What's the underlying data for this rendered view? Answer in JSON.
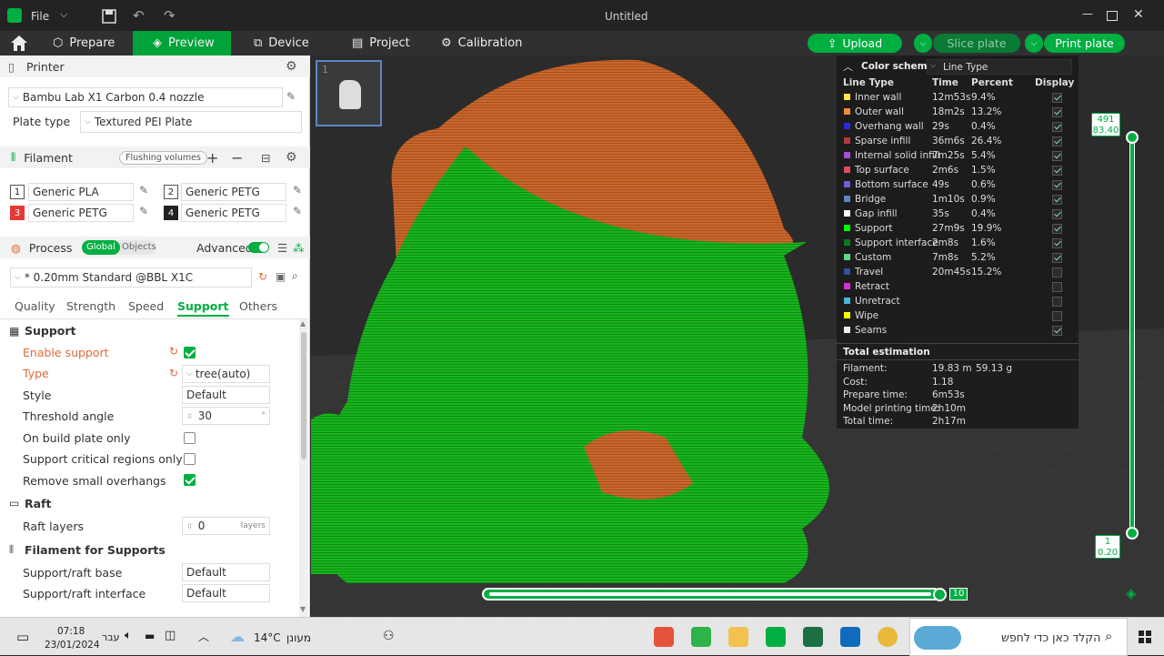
{
  "app": {
    "file_menu": "File",
    "title": "Untitled"
  },
  "nav": {
    "tabs": [
      {
        "label": "Prepare"
      },
      {
        "label": "Preview"
      },
      {
        "label": "Device"
      },
      {
        "label": "Project"
      },
      {
        "label": "Calibration"
      }
    ],
    "upload": "Upload",
    "slice_plate": "Slice plate",
    "print_plate": "Print plate"
  },
  "printer": {
    "header": "Printer",
    "name": "Bambu Lab X1 Carbon 0.4 nozzle",
    "plate_type_label": "Plate type",
    "plate_type": "Textured PEI Plate"
  },
  "filament": {
    "header": "Filament",
    "flushing": "Flushing volumes",
    "slots": [
      {
        "num": "1",
        "name": "Generic PLA",
        "color": "#ffffff"
      },
      {
        "num": "2",
        "name": "Generic PETG",
        "color": "#ffffff"
      },
      {
        "num": "3",
        "name": "Generic PETG",
        "color": "#e53935"
      },
      {
        "num": "4",
        "name": "Generic PETG",
        "color": "#222222"
      }
    ]
  },
  "process": {
    "header": "Process",
    "global": "Global",
    "objects": "Objects",
    "advanced": "Advanced",
    "preset": "* 0.20mm Standard @BBL X1C",
    "tabs": [
      "Quality",
      "Strength",
      "Speed",
      "Support",
      "Others"
    ],
    "active_tab": "Support"
  },
  "support": {
    "section": "Support",
    "enable_support": {
      "label": "Enable support",
      "checked": true
    },
    "type": {
      "label": "Type",
      "value": "tree(auto)"
    },
    "style": {
      "label": "Style",
      "value": "Default"
    },
    "threshold": {
      "label": "Threshold angle",
      "value": "30",
      "unit": "°"
    },
    "build_plate_only": {
      "label": "On build plate only",
      "checked": false
    },
    "critical_only": {
      "label": "Support critical regions only",
      "checked": false
    },
    "remove_small": {
      "label": "Remove small overhangs",
      "checked": true
    }
  },
  "raft": {
    "section": "Raft",
    "layers": {
      "label": "Raft layers",
      "value": "0",
      "unit": "layers"
    }
  },
  "filament_supports": {
    "section": "Filament for Supports",
    "base": {
      "label": "Support/raft base",
      "value": "Default"
    },
    "interface": {
      "label": "Support/raft interface",
      "value": "Default"
    }
  },
  "plate_thumb": {
    "number": "1"
  },
  "legend": {
    "title": "Color scheme",
    "scheme": "Line Type",
    "columns": [
      "Line Type",
      "Time",
      "Percent",
      "Display"
    ],
    "rows": [
      {
        "name": "Inner wall",
        "time": "12m53s",
        "percent": "9.4%",
        "color": "#ffe44d",
        "display": true
      },
      {
        "name": "Outer wall",
        "time": "18m2s",
        "percent": "13.2%",
        "color": "#f08a3c",
        "display": true
      },
      {
        "name": "Overhang wall",
        "time": "29s",
        "percent": "0.4%",
        "color": "#2a2ae0",
        "display": true
      },
      {
        "name": "Sparse infill",
        "time": "36m6s",
        "percent": "26.4%",
        "color": "#b33a3a",
        "display": true
      },
      {
        "name": "Internal solid infill",
        "time": "7m25s",
        "percent": "5.4%",
        "color": "#a34fd6",
        "display": true
      },
      {
        "name": "Top surface",
        "time": "2m6s",
        "percent": "1.5%",
        "color": "#e34a5b",
        "display": true
      },
      {
        "name": "Bottom surface",
        "time": "49s",
        "percent": "0.6%",
        "color": "#6f5fd9",
        "display": true
      },
      {
        "name": "Bridge",
        "time": "1m10s",
        "percent": "0.9%",
        "color": "#5b86c7",
        "display": true
      },
      {
        "name": "Gap infill",
        "time": "35s",
        "percent": "0.4%",
        "color": "#ffffff",
        "display": true
      },
      {
        "name": "Support",
        "time": "27m9s",
        "percent": "19.9%",
        "color": "#00ff00",
        "display": true
      },
      {
        "name": "Support interface",
        "time": "2m8s",
        "percent": "1.6%",
        "color": "#0a7a1e",
        "display": true
      },
      {
        "name": "Custom",
        "time": "7m8s",
        "percent": "5.2%",
        "color": "#5bd98a",
        "display": true
      },
      {
        "name": "Travel",
        "time": "20m45s",
        "percent": "15.2%",
        "color": "#394fa3",
        "display": false
      },
      {
        "name": "Retract",
        "time": "",
        "percent": "",
        "color": "#d92fd9",
        "display": false
      },
      {
        "name": "Unretract",
        "time": "",
        "percent": "",
        "color": "#49b6d6",
        "display": false
      },
      {
        "name": "Wipe",
        "time": "",
        "percent": "",
        "color": "#ffff00",
        "display": false
      },
      {
        "name": "Seams",
        "time": "",
        "percent": "",
        "color": "#eeeeee",
        "display": true
      }
    ],
    "estimation_title": "Total estimation",
    "estimation": [
      {
        "label": "Filament:",
        "value": "19.83 m",
        "value2": "59.13 g"
      },
      {
        "label": "Cost:",
        "value": "1.18",
        "value2": ""
      },
      {
        "label": "Prepare time:",
        "value": "6m53s",
        "value2": ""
      },
      {
        "label": "Model printing time:",
        "value": "2h10m",
        "value2": ""
      },
      {
        "label": "Total time:",
        "value": "2h17m",
        "value2": ""
      }
    ]
  },
  "layer_slider": {
    "top_layer": "491",
    "top_height": "83.40",
    "bottom_layer": "1",
    "bottom_height": "0.20"
  },
  "move_slider": {
    "value": "10"
  },
  "taskbar": {
    "time": "07:18",
    "date": "23/01/2024",
    "lang": "עבר",
    "weather_temp": "14°C",
    "weather_text": "מעונן",
    "search": "הקלד כאן כדי לחפש"
  }
}
